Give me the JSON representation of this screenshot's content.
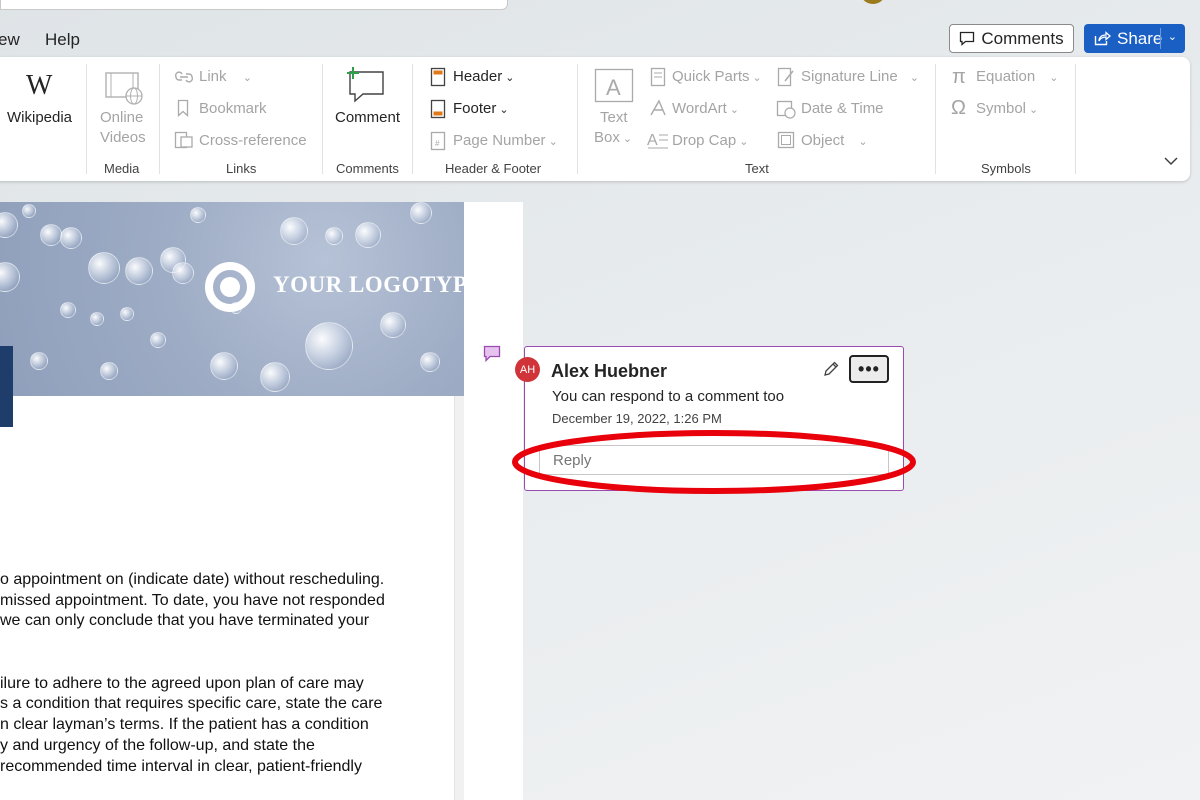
{
  "menu": {
    "items": [
      "ew",
      "Help"
    ]
  },
  "top_buttons": {
    "comments_label": "Comments",
    "share_label": "Share"
  },
  "ribbon": {
    "wikipedia": {
      "icon": "W",
      "label": "Wikipedia"
    },
    "media": {
      "online_videos_l1": "Online",
      "online_videos_l2": "Videos",
      "group": "Media"
    },
    "links": {
      "link": "Link",
      "bookmark": "Bookmark",
      "cross_reference": "Cross-reference",
      "group": "Links"
    },
    "comments": {
      "comment": "Comment",
      "group": "Comments"
    },
    "header_footer": {
      "header": "Header",
      "footer": "Footer",
      "page_number": "Page Number",
      "group": "Header & Footer"
    },
    "text": {
      "text_box_l1": "Text",
      "text_box_l2": "Box",
      "quick_parts": "Quick Parts",
      "wordart": "WordArt",
      "drop_cap": "Drop Cap",
      "signature_line": "Signature Line",
      "date_time": "Date & Time",
      "object": "Object",
      "group": "Text"
    },
    "symbols": {
      "equation": "Equation",
      "symbol": "Symbol",
      "group": "Symbols"
    }
  },
  "document": {
    "logo_text": "YOUR LOGOTYPE",
    "lines": [
      "o appointment on (indicate date) without rescheduling.",
      "missed appointment. To date, you have not responded",
      " we can only conclude that you have terminated your",
      "ilure to adhere to the agreed upon plan of care may",
      "s a condition that requires specific care, state the care",
      "n clear layman’s terms. If the patient has a condition",
      "y and urgency of the follow-up, and state the",
      "recommended time interval in clear, patient-friendly"
    ]
  },
  "comment": {
    "initials": "AH",
    "author": "Alex Huebner",
    "text": "You can respond to a comment too",
    "timestamp": "December 19, 2022, 1:26 PM",
    "more_label": "•••",
    "reply_placeholder": "Reply"
  },
  "colors": {
    "share_blue": "#1a5fc4",
    "comment_border": "#9b4ab0",
    "avatar_red": "#d13438",
    "annotation_red": "#e8000b"
  }
}
